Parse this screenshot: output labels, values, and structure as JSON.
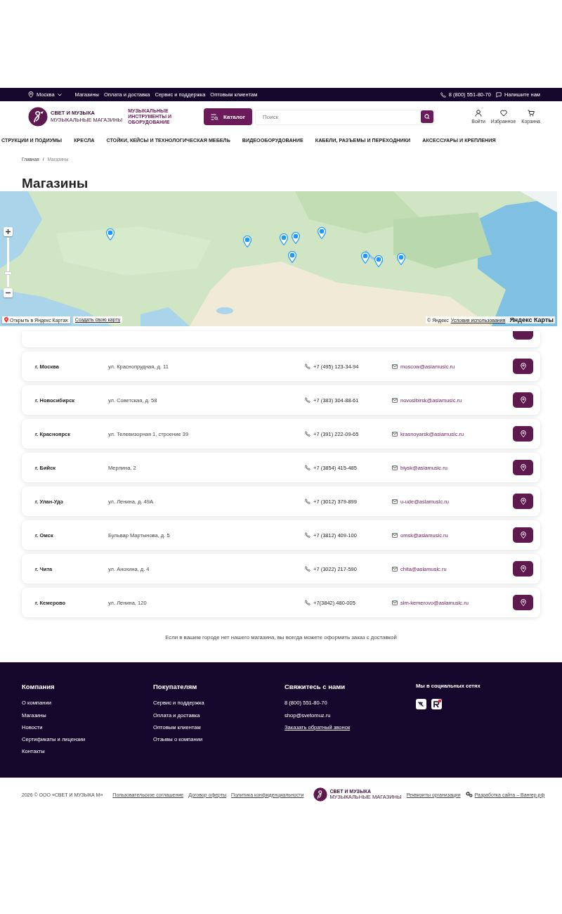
{
  "top_bar": {
    "city": "Москва",
    "links": [
      "Магазины",
      "Оплата и доставка",
      "Сервис и поддержка",
      "Оптовым клиентам"
    ],
    "phone": "8 (800) 551-80-70",
    "message": "Напишите нам"
  },
  "header": {
    "logo_name": "СВЕТ И МУЗЫКА",
    "logo_sub": "МУЗЫКАЛЬНЫЕ МАГАЗИНЫ",
    "tagline": "МУЗЫКАЛЬНЫЕ ИНСТРУМЕНТЫ И ОБОРУДОВАНИЕ",
    "catalog_button": "Каталог",
    "search": {
      "placeholder": "Поиск"
    },
    "actions": [
      {
        "kind": "user",
        "label": "Войти"
      },
      {
        "kind": "heart",
        "label": "Избранное"
      },
      {
        "kind": "cart",
        "label": "Корзина"
      }
    ]
  },
  "nav": [
    "СТРУКЦИИ И ПОДИУМЫ",
    "КРЕСЛА",
    "СТОЙКИ, КЕЙСЫ И ТЕХНОЛОГИЧЕСКАЯ МЕБЕЛЬ",
    "ВИДЕООБОРУДОВАНИЕ",
    "КАБЕЛИ, РАЗЪЕМЫ И ПЕРЕХОДНИКИ",
    "АКСЕССУАРЫ И КРЕПЛЕНИЯ"
  ],
  "breadcrumbs": [
    "Главная",
    "/",
    "Магазины"
  ],
  "title": "Магазины",
  "map": {
    "kind": "picture",
    "zoom": {
      "level": 0.25
    },
    "open_link": "Открыть в Яндекс Картах",
    "create_link": "Создать свою карту",
    "copyright": "© Яндекс",
    "terms": "Условия использования",
    "brand": "Яндекс Карты"
  },
  "stores": [
    {
      "city": "г. Москва",
      "address": "ул. Краснопрудная, д. 11",
      "phone": "+7 (495) 123-34-94",
      "email": "moscow@asiamusic.ru"
    },
    {
      "city": "г. Новосибирск",
      "address": "ул. Советская, д. 58",
      "phone": "+7 (383) 304-88-61",
      "email": "novosibirsk@asiamusic.ru"
    },
    {
      "city": "г. Красноярск",
      "address": "ул. Телевизорная 1, строение 39",
      "phone": "+7 (391) 222-09-65",
      "email": "krasnoyarsk@asiamusic.ru"
    },
    {
      "city": "г. Бийск",
      "address": "Мерлина, 2",
      "phone": "+7 (3854) 415-485",
      "email": "biysk@asiamusic.ru"
    },
    {
      "city": "г. Улан-Удэ",
      "address": "ул. Ленина, д. 49А",
      "phone": "+7 (3012) 379-899",
      "email": "u-ude@asiamusic.ru"
    },
    {
      "city": "г. Омск",
      "address": "Бульвар Мартынова, д. 5",
      "phone": "+7 (3812) 409-100",
      "email": "omsk@asiamusic.ru"
    },
    {
      "city": "г. Чита",
      "address": "ул. Анохина, д. 4",
      "phone": "+7 (3022) 217-590",
      "email": "chita@asiamusic.ru"
    },
    {
      "city": "г. Кемерово",
      "address": "ул. Ленина, 120",
      "phone": "+7(3842) 480-005",
      "email": "sim-kemerovo@asiamusic.ru"
    }
  ],
  "note": "Если в вашем городе нет нашего магазина, вы всегда можете оформить заказ с доставкой",
  "footer": {
    "columns": [
      {
        "title": "Компания",
        "links": [
          "О компании",
          "Магазины",
          "Новости",
          "Сертификаты и лицензии",
          "Контакты"
        ]
      },
      {
        "title": "Покупателям",
        "links": [
          "Сервис и поддержка",
          "Оплата и доставка",
          "Оптовым клиентам",
          "Отзывы о компании"
        ]
      },
      {
        "title": "Свяжитесь с нами",
        "links": [
          "8 (800) 551-80-70",
          "shop@svetomuz.ru"
        ],
        "callback": "Заказать обратный звонок"
      }
    ],
    "social_title": "Мы в социальных сетях",
    "social": [
      {
        "kind": "vk"
      },
      {
        "kind": "rutube"
      }
    ]
  },
  "bottom": {
    "copyright": "2026 © ООО «СВЕТ И МУЗЫКА М»",
    "links": [
      "Пользовательское соглашение",
      "Договор оферты",
      "Политика конфиденциальности"
    ],
    "logo_name": "СВЕТ И МУЗЫКА",
    "logo_sub": "МУЗЫКАЛЬНЫЕ МАГАЗИНЫ",
    "requisites": "Реквизиты организации",
    "developer": "Разработка сайта – Вангер.рф"
  }
}
